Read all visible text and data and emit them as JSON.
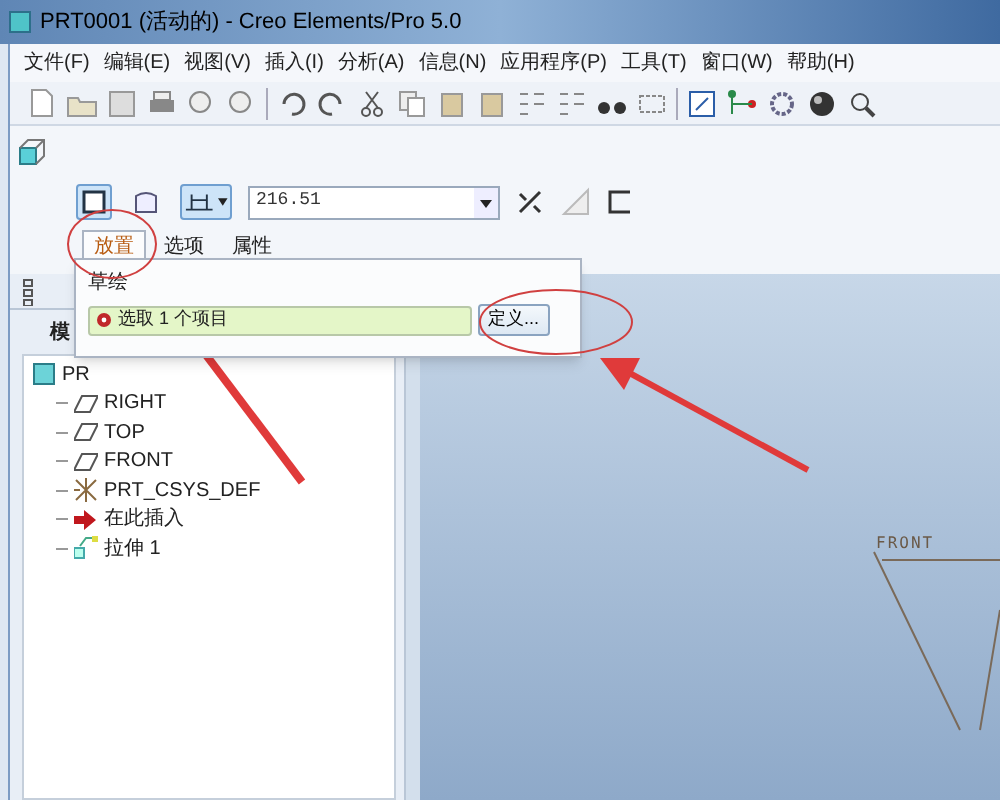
{
  "window": {
    "title": "PRT0001 (活动的) - Creo Elements/Pro 5.0"
  },
  "menu": [
    "文件(F)",
    "编辑(E)",
    "视图(V)",
    "插入(I)",
    "分析(A)",
    "信息(N)",
    "应用程序(P)",
    "工具(T)",
    "窗口(W)",
    "帮助(H)"
  ],
  "dashboard": {
    "type_toggles": [
      {
        "kind": "solid",
        "selected": true
      },
      {
        "kind": "surface",
        "selected": false
      }
    ],
    "depth_value": "216.51",
    "tabs": [
      {
        "label": "放置",
        "selected": true
      },
      {
        "label": "选项",
        "selected": false
      },
      {
        "label": "属性",
        "selected": false
      }
    ],
    "placement_panel": {
      "heading": "草绘",
      "collector": "选取 1 个项目",
      "define_button": "定义..."
    }
  },
  "model_tree": {
    "tab": "模",
    "items": [
      {
        "kind": "part",
        "label": "PR",
        "children": [
          {
            "kind": "plane",
            "label": "RIGHT"
          },
          {
            "kind": "plane",
            "label": "TOP"
          },
          {
            "kind": "plane",
            "label": "FRONT"
          },
          {
            "kind": "csys",
            "label": "PRT_CSYS_DEF"
          },
          {
            "kind": "insert",
            "label": "在此插入"
          },
          {
            "kind": "extrude",
            "label": "拉伸 1"
          }
        ]
      }
    ]
  },
  "graphics": {
    "datum_label": "FRONT"
  }
}
